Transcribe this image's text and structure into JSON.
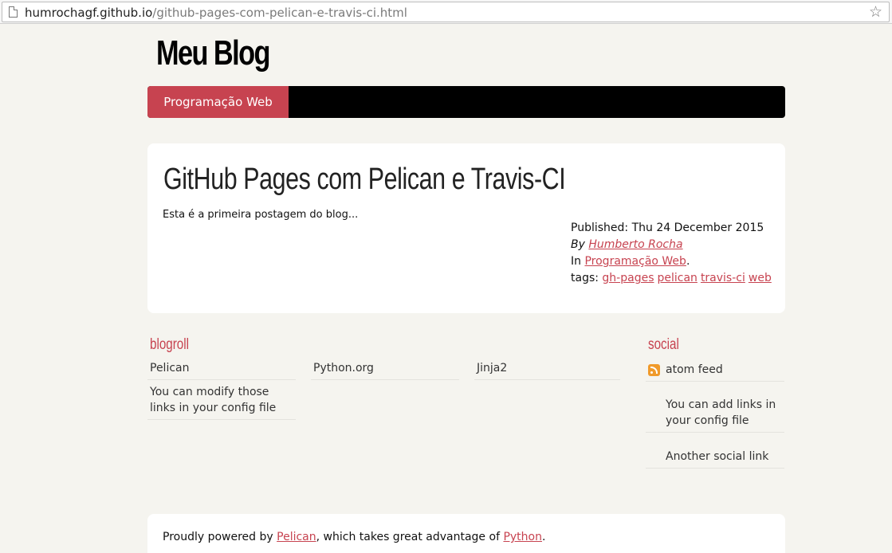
{
  "browser": {
    "url_host": "humrochagf.github.io",
    "url_path": "/github-pages-com-pelican-e-travis-ci.html"
  },
  "site": {
    "title": "Meu Blog"
  },
  "nav": {
    "items": [
      {
        "label": "Programação Web"
      }
    ]
  },
  "article": {
    "title": "GitHub Pages com Pelican e Travis-CI",
    "summary": "Esta é a primeira postagem do blog...",
    "published": "Published: Thu 24 December 2015",
    "by_label": "By",
    "author": "Humberto Rocha",
    "in_label": "In",
    "category": "Programação Web",
    "category_suffix": ".",
    "tags_label": "tags:",
    "tags": [
      "gh-pages",
      "pelican",
      "travis-ci",
      "web"
    ]
  },
  "blogroll": {
    "title": "blogroll",
    "links": [
      "Pelican",
      "Python.org",
      "Jinja2",
      "You can modify those links in your config file"
    ]
  },
  "social": {
    "title": "social",
    "links": [
      "atom feed",
      "You can add links in your config file",
      "Another social link"
    ]
  },
  "footer": {
    "prefix": "Proudly powered by ",
    "pelican": "Pelican",
    "middle": ", which takes great advantage of ",
    "python": "Python",
    "suffix": "."
  },
  "colors": {
    "accent": "#c74350",
    "nav_bg": "#000000",
    "page_bg": "#f5f4ef"
  }
}
